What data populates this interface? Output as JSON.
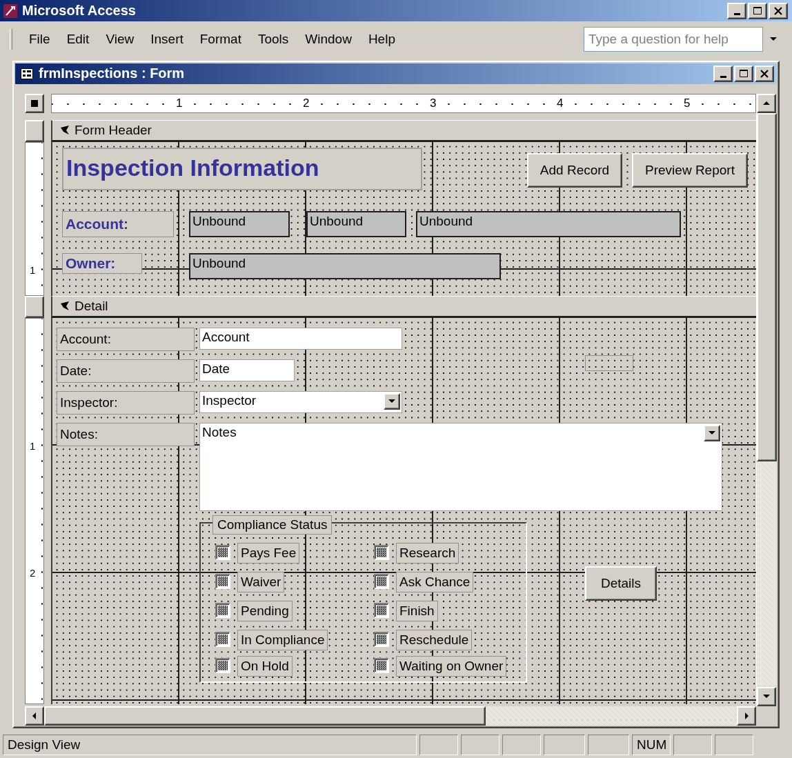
{
  "app": {
    "title": "Microsoft Access"
  },
  "menu": [
    "File",
    "Edit",
    "View",
    "Insert",
    "Format",
    "Tools",
    "Window",
    "Help"
  ],
  "help_box": {
    "placeholder": "Type a question for help"
  },
  "form_window": {
    "title": "frmInspections : Form"
  },
  "ruler": {
    "marks": [
      "1",
      "2",
      "3",
      "4",
      "5"
    ]
  },
  "form_header": {
    "title": "Form Header",
    "ruler_marks": [
      "1"
    ],
    "heading": "Inspection Information",
    "buttons": [
      "Add Record",
      "Preview Report"
    ],
    "account_label": "Account:",
    "account_fields": [
      "Unbound",
      "Unbound",
      "Unbound"
    ],
    "owner_label": "Owner:",
    "owner_field": "Unbound"
  },
  "detail": {
    "title": "Detail",
    "ruler_marks": [
      "1",
      "2"
    ],
    "fields": [
      {
        "label": "Account:",
        "value": "Account",
        "kind": "text"
      },
      {
        "label": "Date:",
        "value": "Date",
        "kind": "text"
      },
      {
        "label": "Inspector:",
        "value": "Inspector",
        "kind": "combo"
      },
      {
        "label": "Notes:",
        "value": "Notes",
        "kind": "memo"
      }
    ],
    "compliance": {
      "title": "Compliance Status",
      "options": [
        {
          "label": "Pays Fee",
          "indeterminate": true
        },
        {
          "label": "Research",
          "indeterminate": true
        },
        {
          "label": "Waiver",
          "indeterminate": true
        },
        {
          "label": "Ask Chance",
          "indeterminate": true
        },
        {
          "label": "Pending",
          "indeterminate": true
        },
        {
          "label": "Finish",
          "indeterminate": true
        },
        {
          "label": "In Compliance",
          "indeterminate": true
        },
        {
          "label": "Reschedule",
          "indeterminate": true
        },
        {
          "label": "On Hold",
          "indeterminate": true
        },
        {
          "label": "Waiting on Owner",
          "indeterminate": true
        }
      ]
    },
    "details_button": "Details"
  },
  "status_bar": {
    "mode": "Design View",
    "num": "NUM"
  }
}
